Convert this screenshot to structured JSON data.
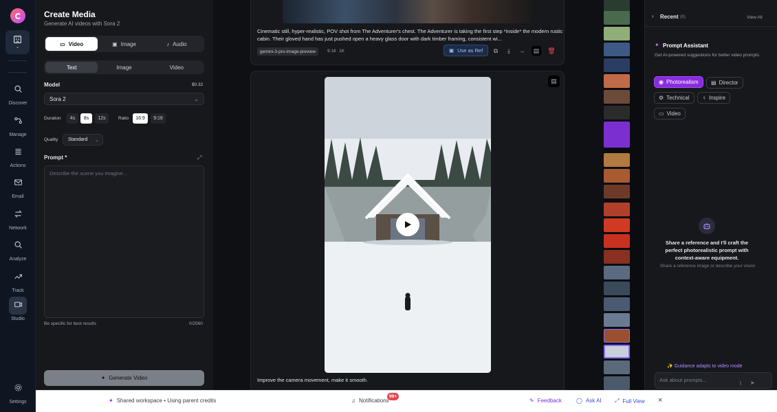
{
  "rail": {
    "workspace_badge": "⌄",
    "items": [
      {
        "label": "Discover",
        "icon": "search-icon"
      },
      {
        "label": "Manage",
        "icon": "manage-icon"
      },
      {
        "label": "Actions",
        "icon": "actions-icon"
      },
      {
        "label": "Email",
        "icon": "email-icon"
      },
      {
        "label": "Network",
        "icon": "network-icon"
      },
      {
        "label": "Analyze",
        "icon": "analyze-icon"
      },
      {
        "label": "Track",
        "icon": "track-icon"
      },
      {
        "label": "Studio",
        "icon": "video-icon"
      }
    ],
    "settings_label": "Settings"
  },
  "left_panel": {
    "title": "Create Media",
    "subtitle": "Generate AI videos with Sora 2",
    "media_tabs": [
      "Video",
      "Image",
      "Audio"
    ],
    "source_tabs": [
      "Text",
      "Image",
      "Video"
    ],
    "model_label": "Model",
    "model_price": "$0.32",
    "model_value": "Sora 2",
    "duration_label": "Duration",
    "durations": [
      "4s",
      "8s",
      "12s"
    ],
    "ratio_label": "Ratio",
    "ratios": [
      "16:9",
      "9:16"
    ],
    "quality_label": "Quality",
    "quality_value": "Standard",
    "prompt_label": "Prompt *",
    "prompt_placeholder": "Describe the scene you imagine...",
    "hint": "Be specific for best results",
    "char_count": "0/2560",
    "generate_label": "Generate Video"
  },
  "main": {
    "card1_text": "Cinematic still, hyper-realistic, POV shot from The Adventurer's chest. The Adventurer is taking the first step *inside* the modern rustic cabin. Their gloved hand has just pushed open a heavy glass door with dark timber framing, consistent wi...",
    "card1_model": "gemini-3-pro-image-preview",
    "card1_ratio": "9:16",
    "card1_res": "1K",
    "use_as_ref": "Use as Ref",
    "card2_text": "Improve the camera movement, make it smooth."
  },
  "right_panel": {
    "recent_label": "Recent",
    "recent_count": "(8)",
    "view_all": "View All",
    "assistant_title": "Prompt Assistant",
    "assistant_desc": "Get AI-powered suggestions for better video prompts",
    "modes": [
      "Photorealism",
      "Director",
      "Technical",
      "Inspire",
      "Video"
    ],
    "empty_title": "Share a reference and I'll craft the perfect photorealistic prompt with context-aware equipment.",
    "empty_sub": "Share a reference image or describe your vision",
    "guidance": "✨ Guidance adapts to video mode",
    "ask_placeholder": "Ask about prompts..."
  },
  "bottom_bar": {
    "workspace_text": "Shared workspace • Using parent credits",
    "notifications": "Notifications",
    "notif_badge": "99+",
    "feedback": "Feedback",
    "ask_ai": "Ask AI",
    "full_view": "Full View"
  },
  "colors": {
    "accent": "#8a2be2",
    "ref_blue": "#9ec3ff",
    "danger": "#e5484d"
  }
}
